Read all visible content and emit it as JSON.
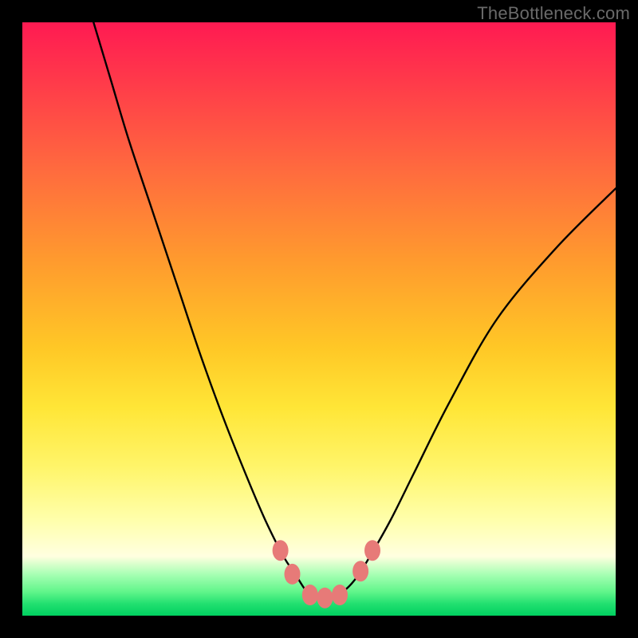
{
  "watermark": "TheBottleneck.com",
  "chart_data": {
    "type": "line",
    "title": "",
    "xlabel": "",
    "ylabel": "",
    "xlim": [
      0,
      100
    ],
    "ylim": [
      0,
      100
    ],
    "series": [
      {
        "name": "bottleneck-curve",
        "x": [
          12,
          15,
          18,
          22,
          26,
          30,
          34,
          38,
          41,
          44,
          46,
          48,
          50,
          52,
          54,
          56,
          58,
          62,
          66,
          72,
          80,
          90,
          100
        ],
        "y": [
          100,
          90,
          80,
          68,
          56,
          44,
          33,
          23,
          16,
          10,
          7,
          4,
          3,
          3,
          4,
          6,
          9,
          16,
          24,
          36,
          50,
          62,
          72
        ]
      }
    ],
    "markers": {
      "name": "highlight-points",
      "color": "#e77a78",
      "points": [
        {
          "x": 43.5,
          "y": 11
        },
        {
          "x": 45.5,
          "y": 7
        },
        {
          "x": 48.5,
          "y": 3.5
        },
        {
          "x": 51,
          "y": 3
        },
        {
          "x": 53.5,
          "y": 3.5
        },
        {
          "x": 57,
          "y": 7.5
        },
        {
          "x": 59,
          "y": 11
        }
      ]
    },
    "background_gradient": {
      "top": "#ff1a52",
      "mid": "#ffe637",
      "bottom": "#00d060"
    }
  }
}
